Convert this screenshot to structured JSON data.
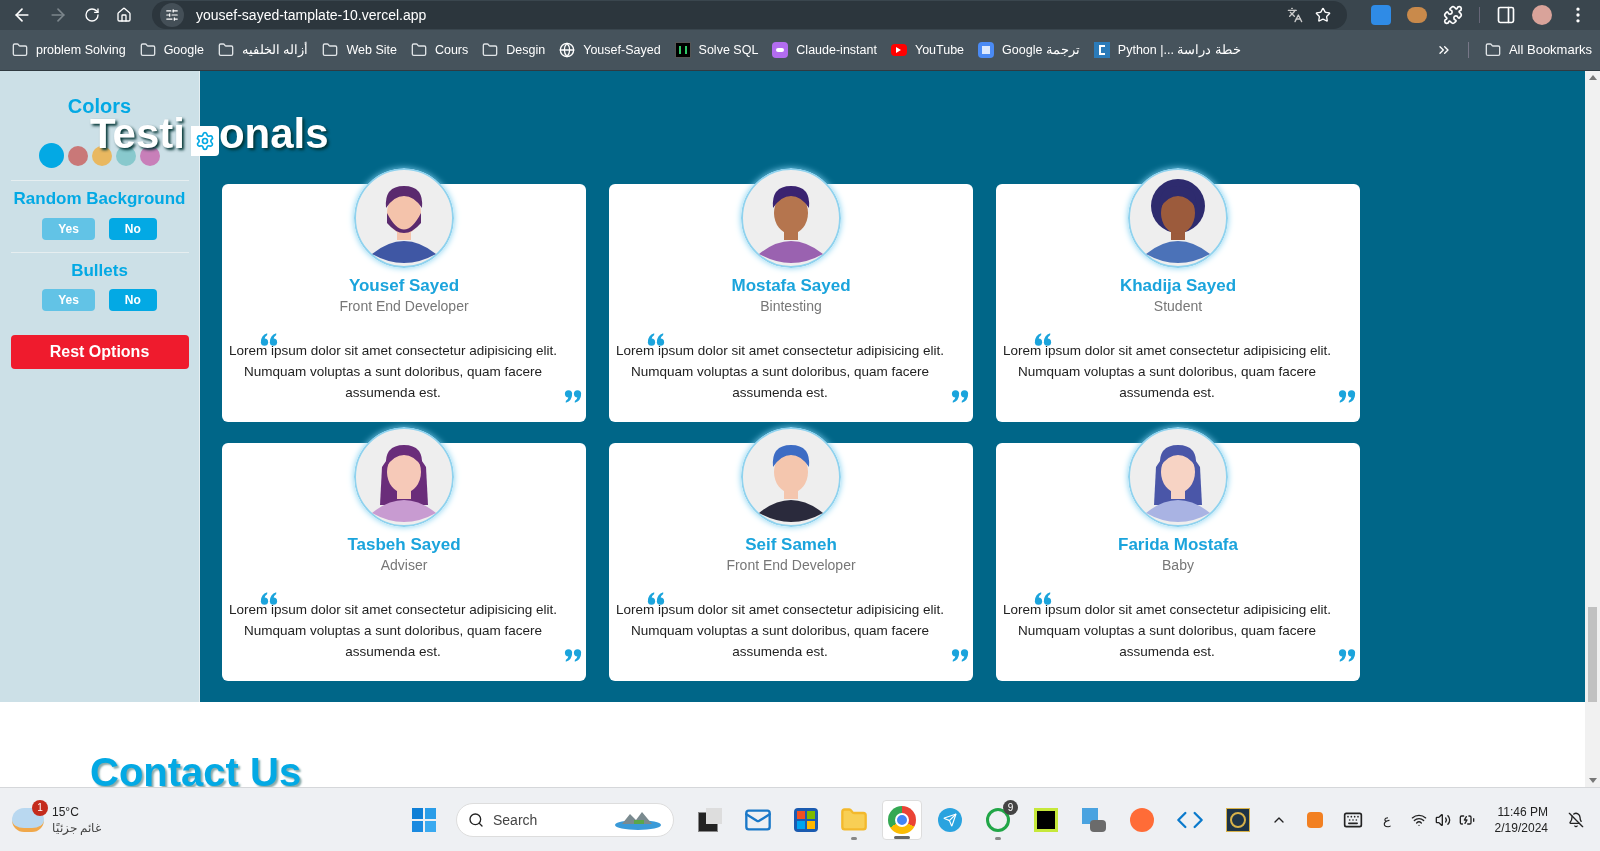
{
  "browser": {
    "url": "yousef-sayed-tamplate-10.vercel.app",
    "forward_disabled": true
  },
  "bookmarks": [
    {
      "kind": "folder",
      "label": "problem Solving"
    },
    {
      "kind": "folder",
      "label": "Google"
    },
    {
      "kind": "folder",
      "label": "أزاله الخلفيه"
    },
    {
      "kind": "folder",
      "label": "Web Site"
    },
    {
      "kind": "folder",
      "label": "Cours"
    },
    {
      "kind": "folder",
      "label": "Desgin"
    },
    {
      "kind": "globe",
      "label": "Yousef-Sayed"
    },
    {
      "kind": "hr",
      "label": "Solve SQL"
    },
    {
      "kind": "bot",
      "label": "Claude-instant"
    },
    {
      "kind": "video",
      "label": "YouTube"
    },
    {
      "kind": "translate",
      "label": "Google ترجمة"
    },
    {
      "kind": "letter",
      "label": "Python |... خطة دراسة"
    }
  ],
  "all_bookmarks": "All Bookmarks",
  "sidebar": {
    "colors_title": "Colors",
    "colors": [
      {
        "color": "#03a9e4",
        "selected": true
      },
      {
        "color": "#c97878",
        "selected": false
      },
      {
        "color": "#e9b860",
        "selected": false
      },
      {
        "color": "#88c9cd",
        "selected": false
      },
      {
        "color": "#c87fb9",
        "selected": false
      }
    ],
    "options": [
      {
        "title": "Random Background",
        "choices": [
          {
            "label": "Yes",
            "selected": false
          },
          {
            "label": "No",
            "selected": true
          }
        ]
      },
      {
        "title": "Bullets",
        "choices": [
          {
            "label": "Yes",
            "selected": false
          },
          {
            "label": "No",
            "selected": true
          }
        ]
      }
    ],
    "reset": "Rest Options"
  },
  "testimonials": {
    "title_parts": [
      "Testi",
      "onals"
    ],
    "cards": [
      {
        "name": "Yousef Sayed",
        "role": "Front End Developer",
        "quote": "Lorem ipsum dolor sit amet consectetur adipisicing elit. Numquam voluptas a sunt doloribus, quam facere assumenda est."
      },
      {
        "name": "Mostafa Sayed",
        "role": "Bintesting",
        "quote": "Lorem ipsum dolor sit amet consectetur adipisicing elit. Numquam voluptas a sunt doloribus, quam facere assumenda est."
      },
      {
        "name": "Khadija Sayed",
        "role": "Student",
        "quote": "Lorem ipsum dolor sit amet consectetur adipisicing elit. Numquam voluptas a sunt doloribus, quam facere assumenda est."
      },
      {
        "name": "Tasbeh Sayed",
        "role": "Adviser",
        "quote": "Lorem ipsum dolor sit amet consectetur adipisicing elit. Numquam voluptas a sunt doloribus, quam facere assumenda est."
      },
      {
        "name": "Seif Sameh",
        "role": "Front End Developer",
        "quote": "Lorem ipsum dolor sit amet consectetur adipisicing elit. Numquam voluptas a sunt doloribus, quam facere assumenda est."
      },
      {
        "name": "Farida Mostafa",
        "role": "Baby",
        "quote": "Lorem ipsum dolor sit amet consectetur adipisicing elit. Numquam voluptas a sunt doloribus, quam facere assumenda est."
      }
    ]
  },
  "contact": {
    "title": "Contact Us"
  },
  "taskbar": {
    "weather": {
      "temp": "15°C",
      "condition": "غائم جزئيًا",
      "badge": "1"
    },
    "search": {
      "placeholder": "Search"
    },
    "apps": [
      {
        "kind": "taskview",
        "running": false,
        "selected": false
      },
      {
        "kind": "mail",
        "running": false,
        "selected": false
      },
      {
        "kind": "store",
        "running": false,
        "selected": false
      },
      {
        "kind": "explorer",
        "running": true,
        "selected": false
      },
      {
        "kind": "chrome",
        "running": true,
        "selected": true
      },
      {
        "kind": "telegram",
        "running": false,
        "selected": false
      },
      {
        "kind": "whatsapp",
        "running": true,
        "selected": false,
        "badge": "9"
      },
      {
        "kind": "pycharm",
        "running": false,
        "selected": false
      },
      {
        "kind": "vpn",
        "running": false,
        "selected": false
      },
      {
        "kind": "postman",
        "running": false,
        "selected": false
      },
      {
        "kind": "vscode",
        "running": false,
        "selected": false
      },
      {
        "kind": "ring",
        "running": false,
        "selected": false
      }
    ],
    "language": "ع",
    "time": "11:46 PM",
    "date": "2/19/2024"
  }
}
